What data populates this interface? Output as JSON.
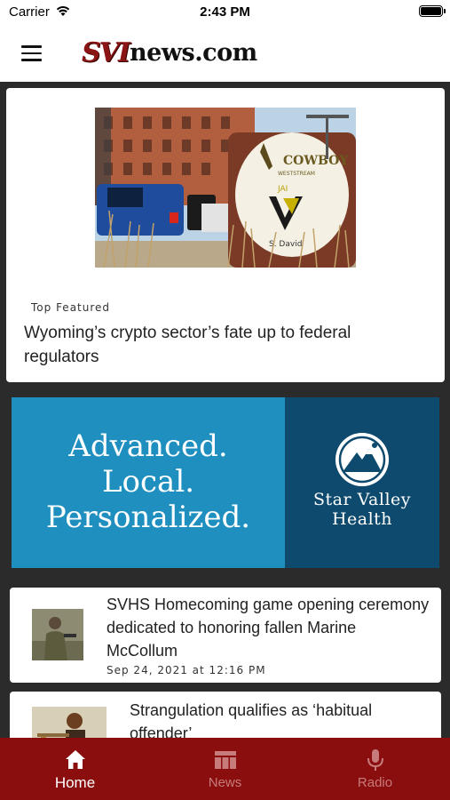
{
  "status_bar": {
    "carrier": "Carrier",
    "time": "2:43 PM"
  },
  "header": {
    "logo_svi": "SVI",
    "logo_rest": "news.com"
  },
  "featured": {
    "tag": "Top Featured",
    "title": "Wyoming’s crypto sector’s fate up to federal regulators",
    "sign_text": "COWBOY",
    "sign_sub": "WESTSTREAM",
    "sign_brand": "JAI",
    "sign_street": "S. David"
  },
  "ad": {
    "lines": [
      "Advanced.",
      "Local.",
      "Personalized."
    ],
    "brand_line1": "Star Valley",
    "brand_line2": "Health",
    "colors": {
      "left": "#1f8fc0",
      "right": "#0e4a6d"
    }
  },
  "articles": [
    {
      "title": "SVHS Homecoming game opening ceremony dedicated to honoring fallen Marine McCollum",
      "date": "Sep 24, 2021 at 12:16 PM"
    },
    {
      "title": "Strangulation qualifies as ‘habitual offender’",
      "date": ""
    }
  ],
  "tabs": [
    {
      "label": "Home",
      "icon": "home-icon",
      "active": true
    },
    {
      "label": "News",
      "icon": "newspaper-icon",
      "active": false
    },
    {
      "label": "Radio",
      "icon": "microphone-icon",
      "active": false
    }
  ],
  "colors": {
    "tabbar": "#8b0e0e",
    "brand_red": "#8b1414"
  }
}
